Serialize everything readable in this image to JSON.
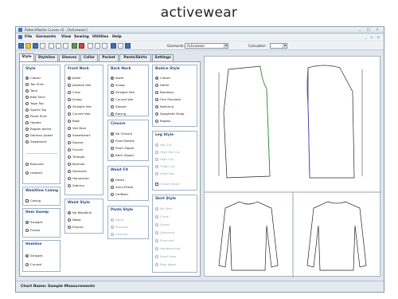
{
  "page_title": "activewear",
  "window": {
    "title": "PatternMaster Curves v5 - [Activewear]",
    "controls": [
      "_",
      "□",
      "×"
    ],
    "menu": [
      "File",
      "Garments",
      "View",
      "Sewing",
      "Utilities",
      "Help"
    ],
    "toolbar": {
      "garments_label": "Garments:",
      "garments_value": "Activewear",
      "calculator_label": "Calculator:"
    },
    "tabs": [
      "Style",
      "Styleline",
      "Sleeves",
      "Collar",
      "Pocket",
      "Pants/Skirts",
      "Settings"
    ]
  },
  "style_group": {
    "title": "Style",
    "options": [
      "Classic",
      "Tee Shirt",
      "Tank",
      "Bike Shirt",
      "Yoga Top",
      "Sports Top",
      "Panel Shirt",
      "Hoodie",
      "Raglan Jacket",
      "Dolman Jacket",
      "Sweatshirt",
      "Bodysuit",
      "Leotard"
    ],
    "selected": "Classic"
  },
  "waistline_casing": {
    "title": "Waistline Casing",
    "option": "Casing"
  },
  "hem_sweep": {
    "title": "Hem Sweep",
    "options": [
      "Straight",
      "Flared"
    ],
    "selected": "Straight"
  },
  "hemline": {
    "title": "Hemline",
    "options": [
      "Straight",
      "Curved"
    ],
    "selected": "Straight"
  },
  "front_neck": {
    "title": "Front Neck",
    "options": [
      "Jewel",
      "Jeweled Vee",
      "Crew",
      "Scoop",
      "Straight Vee",
      "Curved Vee",
      "Boat",
      "Vee Bust",
      "Sweetheart",
      "Square",
      "Funnel",
      "Triangle",
      "Keyhole",
      "Diamond",
      "Horseshoe",
      "Sabrina"
    ],
    "selected": "Jewel"
  },
  "waist_style": {
    "title": "Waist Style",
    "options": [
      "No Waistline",
      "Waist",
      "Empire"
    ],
    "selected": "No Waistline"
  },
  "back_neck": {
    "title": "Back Neck",
    "options": [
      "Jewel",
      "Scoop",
      "Straight Vee",
      "Curved Vee",
      "Square",
      "Racing"
    ],
    "selected": "Jewel"
  },
  "closure": {
    "title": "Closure",
    "options": [
      "No Closure",
      "Front Button",
      "Front Zipper",
      "Back Zipper"
    ],
    "selected": "No Closure"
  },
  "waist_fit": {
    "title": "Waist Fit",
    "options": [
      "Fitted",
      "Semi-Fitted",
      "Unfitted"
    ],
    "selected": "Fitted"
  },
  "pants_style": {
    "title": "Pants Style",
    "options": [
      "None",
      "Princess",
      "Sleeved"
    ],
    "selected": "None"
  },
  "bodice_style": {
    "title": "Bodice Style",
    "options": [
      "Classic",
      "Halter",
      "Bandeau",
      "One Shoulder",
      "Ballerina",
      "Spaghetti Strap",
      "Raglan"
    ],
    "selected": "Classic"
  },
  "leg_style": {
    "title": "Leg Style",
    "options": [
      "Hip Cut",
      "High Hip Cut",
      "High Cut",
      "Thigh Cut",
      "Little Boy"
    ],
    "checkbox": "Crotch Panel"
  },
  "skirt_style": {
    "title": "Skirt Style",
    "options": [
      "No Skirt",
      "Circle",
      "Gored",
      "Gathered",
      "Flounced",
      "Handkerchief",
      "Scarf Hem",
      "Bias Waist"
    ]
  },
  "status": {
    "chart_label": "Chart Name:",
    "chart_value": "Sample Measurements"
  },
  "colors": {
    "accent": "#2b4a78",
    "pattern_line": "#222222",
    "front_seam": "#3a9a3a",
    "back_seam": "#4a4ac8"
  }
}
